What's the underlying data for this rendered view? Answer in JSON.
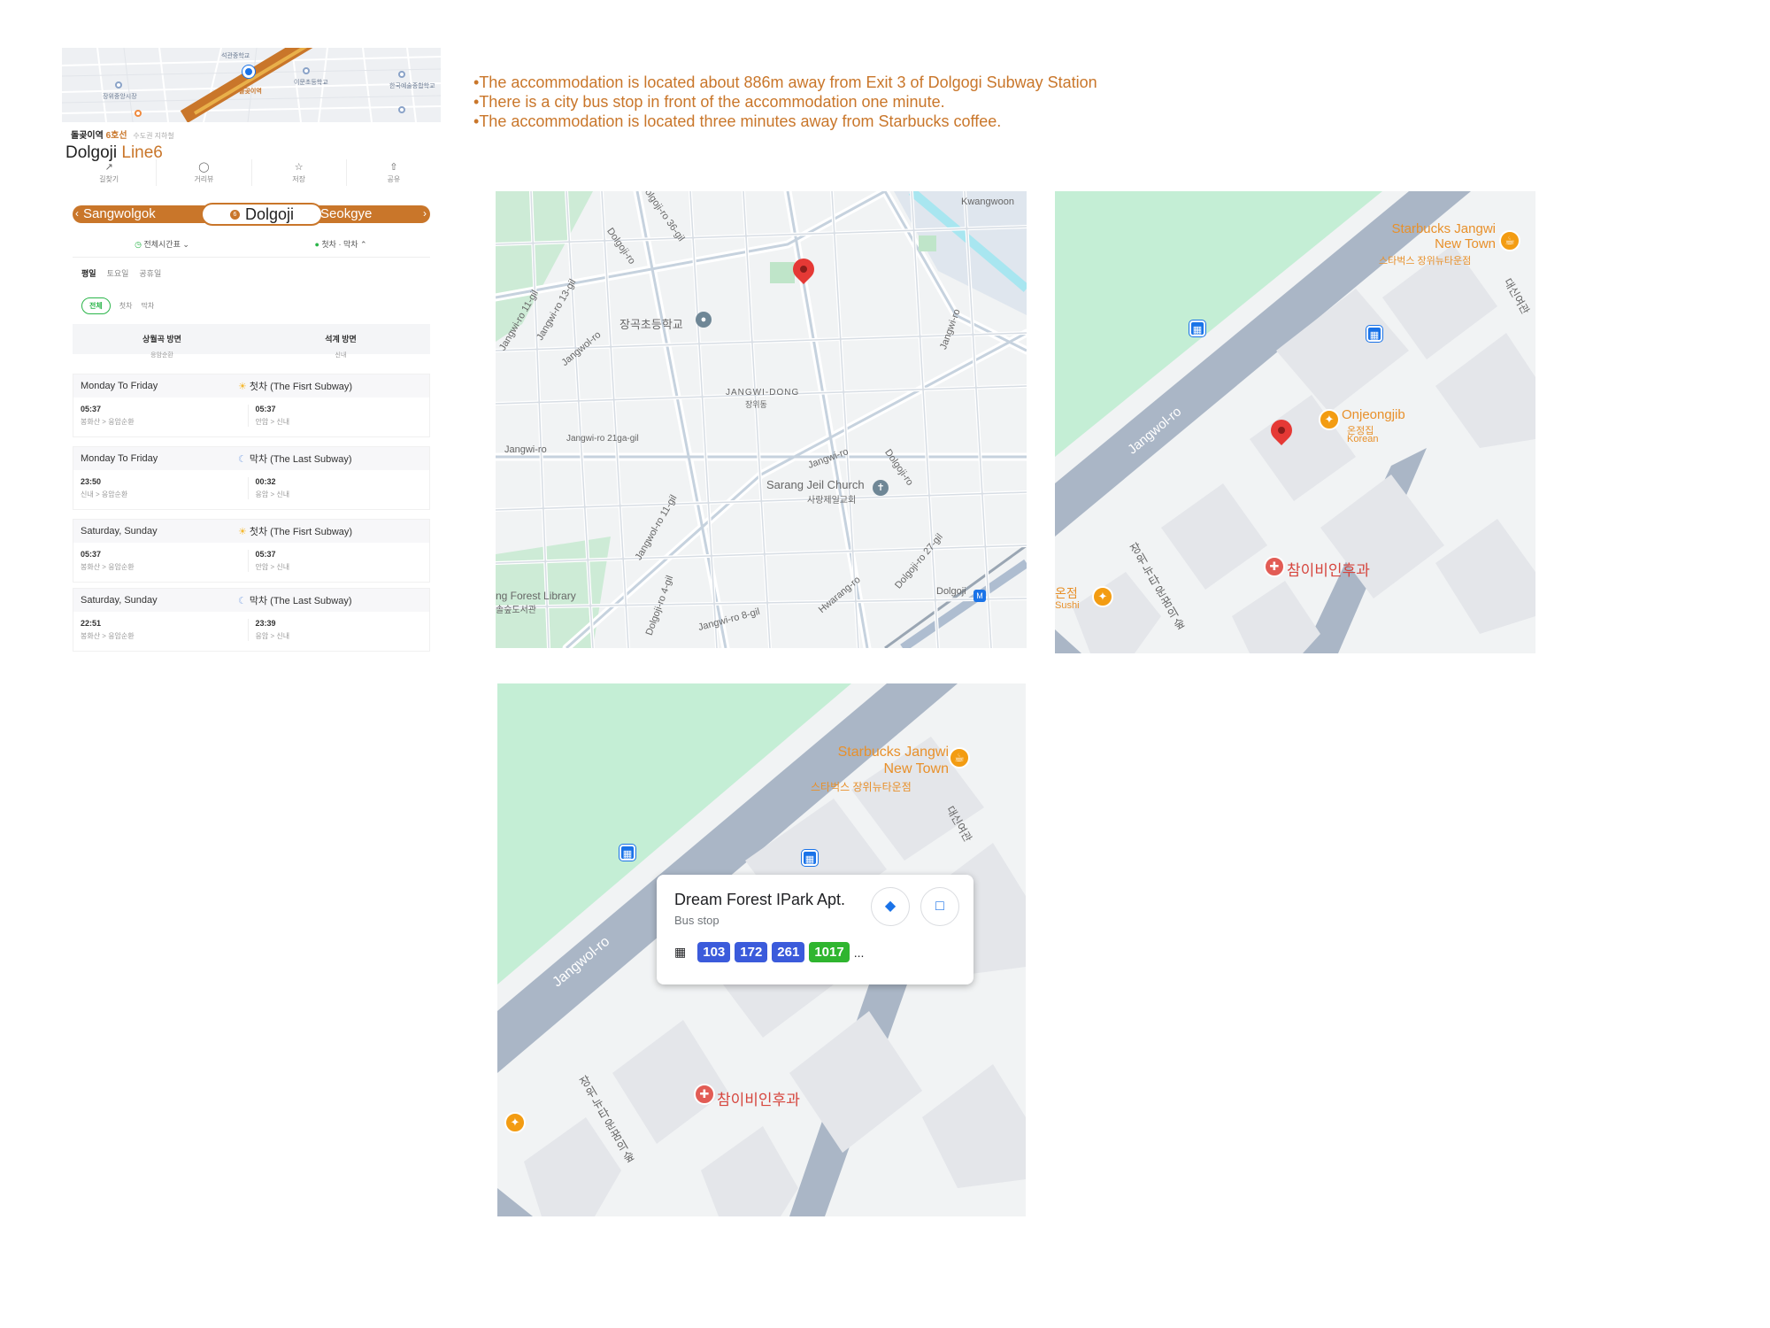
{
  "station": {
    "name_kr": "돌곶이역",
    "line_kr": "6호선",
    "region_kr": "수도권 지하철",
    "title_en": "Dolgoji",
    "line_en": "Line6",
    "actions": [
      "길찾기",
      "거리뷰",
      "저장",
      "공유"
    ],
    "prev_station": "Sangwolgok",
    "current_station": "Dolgoji",
    "next_station": "Seokgye",
    "toggle_all": "전체시간표",
    "toggle_firstlast": "첫차 · 막차",
    "day_tabs": [
      "평일",
      "토요일",
      "공휴일"
    ],
    "filters": [
      "전체",
      "첫차",
      "막차"
    ],
    "dir_left_title": "상월곡 방면",
    "dir_left_sub": "응암순환",
    "dir_right_title": "석계 방면",
    "dir_right_sub": "신내",
    "mini_labels": [
      "돌곶이역",
      "석관중학교",
      "장위중앙시장",
      "이문초등학교",
      "한국예술종합학교"
    ]
  },
  "schedules": [
    {
      "day": "Monday To Friday",
      "icon": "sun-icon",
      "kind": "첫차 (The Fisrt Subway)",
      "left_time": "05:37",
      "left_route": "봉화산 > 응암순환",
      "right_time": "05:37",
      "right_route": "안암 > 신내"
    },
    {
      "day": "Monday To Friday",
      "icon": "moon-icon",
      "kind": "막차 (The Last Subway)",
      "left_time": "23:50",
      "left_route": "신내 > 응암순환",
      "right_time": "00:32",
      "right_route": "응암 > 신내"
    },
    {
      "day": "Saturday, Sunday",
      "icon": "sun-icon",
      "kind": "첫차 (The Fisrt Subway)",
      "left_time": "05:37",
      "left_route": "봉화산 > 응암순환",
      "right_time": "05:37",
      "right_route": "안암 > 신내"
    },
    {
      "day": "Saturday, Sunday",
      "icon": "moon-icon",
      "kind": "막차 (The Last Subway)",
      "left_time": "22:51",
      "left_route": "봉화산 > 응암순환",
      "right_time": "23:39",
      "right_route": "응암 > 신내"
    }
  ],
  "notes": [
    "The accommodation is located about 886m away from Exit 3 of Dolgogi Subway Station",
    "There is a city bus stop in front of the accommodation one minute.",
    "The accommodation is located three minutes away from Starbucks coffee."
  ],
  "map1": {
    "labels": {
      "kwangwoon": "Kwangwoon",
      "school": "장곡초등학교",
      "district_en": "JANGWI-DONG",
      "district_kr": "장위동",
      "church_en": "Sarang Jeil Church",
      "church_kr": "사랑제일교회",
      "library_en": "ng Forest Library",
      "library_kr": "솔숲도서관",
      "station": "Dolgoji",
      "road_jangwi": "Jangwi-ro",
      "road_jangwi21": "Jangwi-ro 21ga-gil",
      "road_dolgoji": "Dolgoji-ro",
      "road_jangwol": "Jangwol-ro",
      "road_hwarang": "Hwarang-ro",
      "road_dolgoji27": "Dolgoji-ro 27-gil",
      "road_jangwol11": "Jangwol-ro 11-gil",
      "road_jangwi8": "Jangwi-ro 8-gil",
      "road_jangwi11": "Jangwi-ro 11-gil",
      "road_jangwi13": "Jangwi-ro 13-gil",
      "road_dolgoji4": "Dolgoji-ro 4-gil",
      "road_dolgoji36": "Dolgoji-ro 36-gil"
    }
  },
  "map2": {
    "starbucks_en": "Starbucks Jangwi\nNew Town",
    "starbucks_kr": "스타벅스 장위뉴타운점",
    "road": "Jangwol-ro",
    "onjeong_en": "Onjeongjib",
    "onjeong_kr": "온정집",
    "onjeong_type": "Korean",
    "clinic": "참이비인후과",
    "sushi_kr": "온점",
    "sushi_en": "Sushi",
    "building": "장위뉴타운 꿈의숲",
    "corner": "대신여관"
  },
  "map3": {
    "starbucks_en": "Starbucks Jangwi\nNew Town",
    "starbucks_kr": "스타벅스 장위뉴타운점",
    "road": "Jangwol-ro",
    "clinic": "참이비인후과",
    "building": "장위뉴타운 꿈의숲",
    "corner": "대신여관"
  },
  "bus_popup": {
    "title": "Dream Forest IPark Apt.",
    "subtitle": "Bus stop",
    "routes": [
      {
        "num": "103",
        "color": "#3b5bdb"
      },
      {
        "num": "172",
        "color": "#3b5bdb"
      },
      {
        "num": "261",
        "color": "#3b5bdb"
      },
      {
        "num": "1017",
        "color": "#2fb52f"
      }
    ],
    "more": "...",
    "directions_icon": "directions-icon",
    "save_icon": "bookmark-icon"
  }
}
